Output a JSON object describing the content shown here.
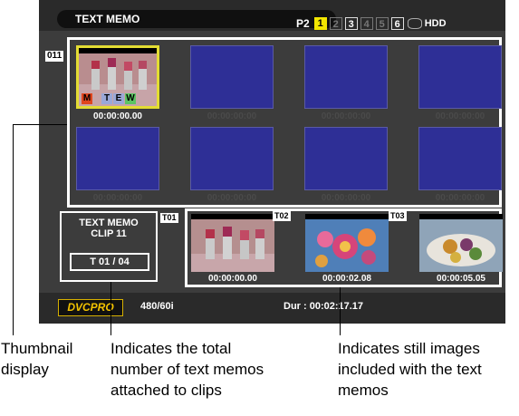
{
  "header": {
    "title": "TEXT MEMO",
    "media_label": "P2",
    "slots": [
      {
        "label": "1",
        "state": "active"
      },
      {
        "label": "2",
        "state": "dim"
      },
      {
        "label": "3",
        "state": "box"
      },
      {
        "label": "4",
        "state": "dim"
      },
      {
        "label": "5",
        "state": "dim"
      },
      {
        "label": "6",
        "state": "box"
      }
    ],
    "hdd_label": "HDD"
  },
  "grid": {
    "clip_number": "011",
    "thumbnails": [
      {
        "timecode": "00:00:00.00",
        "selected": true,
        "badges": [
          "M",
          "T",
          "E",
          "W"
        ]
      },
      {
        "timecode": "00:00:00:00",
        "selected": false
      },
      {
        "timecode": "00:00:00:00",
        "selected": false
      },
      {
        "timecode": "00:00:00:00",
        "selected": false
      },
      {
        "timecode": "00:00:00:00",
        "selected": false
      },
      {
        "timecode": "00:00:00:00",
        "selected": false
      },
      {
        "timecode": "00:00:00:00",
        "selected": false
      },
      {
        "timecode": "00:00:00:00",
        "selected": false
      }
    ]
  },
  "memo_info": {
    "line1": "TEXT MEMO",
    "line2": "CLIP 11",
    "count": "T 01   / 04"
  },
  "stills": [
    {
      "label": "T01",
      "timecode": "00:00:00.00"
    },
    {
      "label": "T02",
      "timecode": "00:00:02.08"
    },
    {
      "label": "T03",
      "timecode": "00:00:05.05"
    }
  ],
  "status": {
    "codec": "DVCPRO",
    "format": "480/60i",
    "duration": "Dur : 00:02:17.17"
  },
  "annotations": {
    "thumbnail": "Thumbnail\ndisplay",
    "total": "Indicates the total\nnumber of text memos\nattached to clips",
    "stills": "Indicates still images\nincluded with the text\nmemos"
  },
  "colors": {
    "screen_bg": "#3c3c3c",
    "thumb_empty": "#2e2f96",
    "selection": "#e3dc33",
    "active_slot": "#f2e600",
    "codec_text": "#f2c200"
  }
}
